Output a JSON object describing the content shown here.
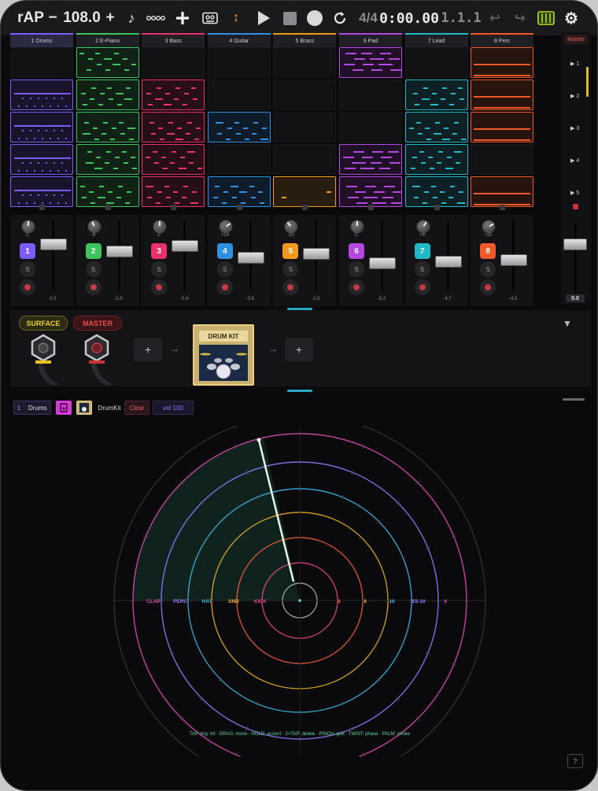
{
  "topbar": {
    "app_name": "rAP",
    "tempo_minus": "−",
    "tempo": "108.0",
    "tempo_plus": "+",
    "time_signature": "4/4",
    "time_display": "0:00.00",
    "bar_position": "1.1.1"
  },
  "tracks": [
    {
      "number": "1",
      "name": "1 Drums",
      "color": "#7c5cff",
      "pan": "C",
      "volume_db": "0.0"
    },
    {
      "number": "2",
      "name": "2 E-Piano",
      "color": "#3ec45c",
      "pan": "-6",
      "volume_db": "-1.9"
    },
    {
      "number": "3",
      "name": "3 Bass",
      "color": "#e8336a",
      "pan": "C",
      "volume_db": "-0.4"
    },
    {
      "number": "4",
      "name": "4 Guitar",
      "color": "#2f8fe0",
      "pan": "+14",
      "volume_db": "-3.6"
    },
    {
      "number": "5",
      "name": "5 Brass",
      "color": "#f39a1c",
      "pan": "-10",
      "volume_db": "-2.6"
    },
    {
      "number": "6",
      "name": "6 Pad",
      "color": "#b447e0",
      "pan": "C",
      "volume_db": "-5.2"
    },
    {
      "number": "7",
      "name": "7 Lead",
      "color": "#22b8c8",
      "pan": "+8",
      "volume_db": "-4.7"
    },
    {
      "number": "8",
      "name": "8 Perc",
      "color": "#f05a28",
      "pan": "+15",
      "volume_db": "-4.2"
    }
  ],
  "mixer": {
    "solo_label": "S",
    "master_label": "Master",
    "master_db": "0.0"
  },
  "scenes": [
    "▶ 1",
    "▶ 2",
    "▶ 3",
    "▶ 4",
    "▶ 5"
  ],
  "fx": {
    "surface_label": "SURFACE",
    "master_label": "MASTER",
    "add_label": "+",
    "arrow": "→",
    "instrument_name": "DRUM KIT",
    "collapse_icon": "▼"
  },
  "editor": {
    "track_number": "1",
    "track_name": "Drums",
    "instrument": "DrumKit",
    "clear_label": "Clear",
    "velocity_label": "vel 100"
  },
  "radial": {
    "left_labels": [
      {
        "text": "CLAP",
        "color": "#e050b8"
      },
      {
        "text": "PERC",
        "color": "#9a7cff"
      },
      {
        "text": "HAT",
        "color": "#3fb8e8"
      },
      {
        "text": "SNR",
        "color": "#e8b030"
      },
      {
        "text": "KICK",
        "color": "#e84a8a"
      }
    ],
    "right_labels": [
      {
        "text": "8",
        "color": "#f0603a"
      },
      {
        "text": "8",
        "color": "#e8b030"
      },
      {
        "text": "16",
        "color": "#3fb8e8"
      },
      {
        "text": "E5-16",
        "color": "#9a7cff"
      },
      {
        "text": "4",
        "color": "#e050b8"
      }
    ],
    "playhead_fraction": 0.965
  },
  "hint_text": "TAP ring: hit · DRAG: move · HOLD: accent · 2×TAP: delete · PINCH: grid · TWIST: phase · PALM: choke",
  "help_label": "?"
}
